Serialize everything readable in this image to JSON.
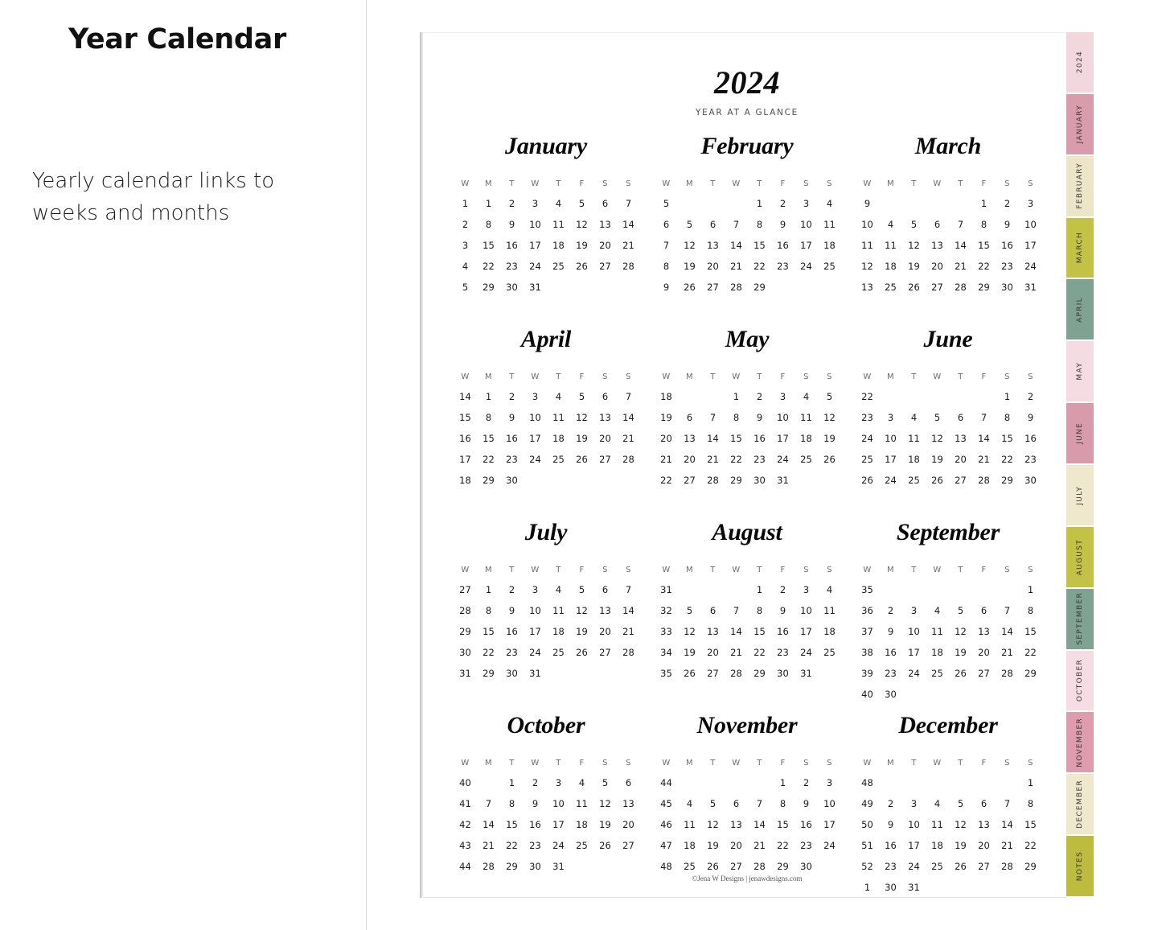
{
  "left_panel": {
    "title": "Year Calendar",
    "description": "Yearly calendar links to weeks and months"
  },
  "calendar": {
    "year": "2024",
    "subtitle": "YEAR AT A GLANCE",
    "footer": "©Jena W Designs | jenawdesigns.com",
    "day_headers": [
      "W",
      "M",
      "T",
      "W",
      "T",
      "F",
      "S",
      "S"
    ],
    "months": [
      {
        "name": "January",
        "rows": [
          [
            "1",
            "1",
            "2",
            "3",
            "4",
            "5",
            "6",
            "7"
          ],
          [
            "2",
            "8",
            "9",
            "10",
            "11",
            "12",
            "13",
            "14"
          ],
          [
            "3",
            "15",
            "16",
            "17",
            "18",
            "19",
            "20",
            "21"
          ],
          [
            "4",
            "22",
            "23",
            "24",
            "25",
            "26",
            "27",
            "28"
          ],
          [
            "5",
            "29",
            "30",
            "31",
            "",
            "",
            "",
            ""
          ]
        ]
      },
      {
        "name": "February",
        "rows": [
          [
            "5",
            "",
            "",
            "",
            "1",
            "2",
            "3",
            "4"
          ],
          [
            "6",
            "5",
            "6",
            "7",
            "8",
            "9",
            "10",
            "11"
          ],
          [
            "7",
            "12",
            "13",
            "14",
            "15",
            "16",
            "17",
            "18"
          ],
          [
            "8",
            "19",
            "20",
            "21",
            "22",
            "23",
            "24",
            "25"
          ],
          [
            "9",
            "26",
            "27",
            "28",
            "29",
            "",
            "",
            ""
          ]
        ]
      },
      {
        "name": "March",
        "rows": [
          [
            "9",
            "",
            "",
            "",
            "",
            "1",
            "2",
            "3"
          ],
          [
            "10",
            "4",
            "5",
            "6",
            "7",
            "8",
            "9",
            "10"
          ],
          [
            "11",
            "11",
            "12",
            "13",
            "14",
            "15",
            "16",
            "17"
          ],
          [
            "12",
            "18",
            "19",
            "20",
            "21",
            "22",
            "23",
            "24"
          ],
          [
            "13",
            "25",
            "26",
            "27",
            "28",
            "29",
            "30",
            "31"
          ]
        ]
      },
      {
        "name": "April",
        "rows": [
          [
            "14",
            "1",
            "2",
            "3",
            "4",
            "5",
            "6",
            "7"
          ],
          [
            "15",
            "8",
            "9",
            "10",
            "11",
            "12",
            "13",
            "14"
          ],
          [
            "16",
            "15",
            "16",
            "17",
            "18",
            "19",
            "20",
            "21"
          ],
          [
            "17",
            "22",
            "23",
            "24",
            "25",
            "26",
            "27",
            "28"
          ],
          [
            "18",
            "29",
            "30",
            "",
            "",
            "",
            "",
            ""
          ]
        ]
      },
      {
        "name": "May",
        "rows": [
          [
            "18",
            "",
            "",
            "1",
            "2",
            "3",
            "4",
            "5"
          ],
          [
            "19",
            "6",
            "7",
            "8",
            "9",
            "10",
            "11",
            "12"
          ],
          [
            "20",
            "13",
            "14",
            "15",
            "16",
            "17",
            "18",
            "19"
          ],
          [
            "21",
            "20",
            "21",
            "22",
            "23",
            "24",
            "25",
            "26"
          ],
          [
            "22",
            "27",
            "28",
            "29",
            "30",
            "31",
            "",
            ""
          ]
        ]
      },
      {
        "name": "June",
        "rows": [
          [
            "22",
            "",
            "",
            "",
            "",
            "",
            "1",
            "2"
          ],
          [
            "23",
            "3",
            "4",
            "5",
            "6",
            "7",
            "8",
            "9"
          ],
          [
            "24",
            "10",
            "11",
            "12",
            "13",
            "14",
            "15",
            "16"
          ],
          [
            "25",
            "17",
            "18",
            "19",
            "20",
            "21",
            "22",
            "23"
          ],
          [
            "26",
            "24",
            "25",
            "26",
            "27",
            "28",
            "29",
            "30"
          ]
        ]
      },
      {
        "name": "July",
        "rows": [
          [
            "27",
            "1",
            "2",
            "3",
            "4",
            "5",
            "6",
            "7"
          ],
          [
            "28",
            "8",
            "9",
            "10",
            "11",
            "12",
            "13",
            "14"
          ],
          [
            "29",
            "15",
            "16",
            "17",
            "18",
            "19",
            "20",
            "21"
          ],
          [
            "30",
            "22",
            "23",
            "24",
            "25",
            "26",
            "27",
            "28"
          ],
          [
            "31",
            "29",
            "30",
            "31",
            "",
            "",
            "",
            ""
          ]
        ]
      },
      {
        "name": "August",
        "rows": [
          [
            "31",
            "",
            "",
            "",
            "1",
            "2",
            "3",
            "4"
          ],
          [
            "32",
            "5",
            "6",
            "7",
            "8",
            "9",
            "10",
            "11"
          ],
          [
            "33",
            "12",
            "13",
            "14",
            "15",
            "16",
            "17",
            "18"
          ],
          [
            "34",
            "19",
            "20",
            "21",
            "22",
            "23",
            "24",
            "25"
          ],
          [
            "35",
            "26",
            "27",
            "28",
            "29",
            "30",
            "31",
            ""
          ]
        ]
      },
      {
        "name": "September",
        "rows": [
          [
            "35",
            "",
            "",
            "",
            "",
            "",
            "",
            "1"
          ],
          [
            "36",
            "2",
            "3",
            "4",
            "5",
            "6",
            "7",
            "8"
          ],
          [
            "37",
            "9",
            "10",
            "11",
            "12",
            "13",
            "14",
            "15"
          ],
          [
            "38",
            "16",
            "17",
            "18",
            "19",
            "20",
            "21",
            "22"
          ],
          [
            "39",
            "23",
            "24",
            "25",
            "26",
            "27",
            "28",
            "29"
          ],
          [
            "40",
            "30",
            "",
            "",
            "",
            "",
            "",
            ""
          ]
        ]
      },
      {
        "name": "October",
        "rows": [
          [
            "40",
            "",
            "1",
            "2",
            "3",
            "4",
            "5",
            "6"
          ],
          [
            "41",
            "7",
            "8",
            "9",
            "10",
            "11",
            "12",
            "13"
          ],
          [
            "42",
            "14",
            "15",
            "16",
            "17",
            "18",
            "19",
            "20"
          ],
          [
            "43",
            "21",
            "22",
            "23",
            "24",
            "25",
            "26",
            "27"
          ],
          [
            "44",
            "28",
            "29",
            "30",
            "31",
            "",
            "",
            ""
          ]
        ]
      },
      {
        "name": "November",
        "rows": [
          [
            "44",
            "",
            "",
            "",
            "",
            "1",
            "2",
            "3"
          ],
          [
            "45",
            "4",
            "5",
            "6",
            "7",
            "8",
            "9",
            "10"
          ],
          [
            "46",
            "11",
            "12",
            "13",
            "14",
            "15",
            "16",
            "17"
          ],
          [
            "47",
            "18",
            "19",
            "20",
            "21",
            "22",
            "23",
            "24"
          ],
          [
            "48",
            "25",
            "26",
            "27",
            "28",
            "29",
            "30",
            ""
          ]
        ]
      },
      {
        "name": "December",
        "rows": [
          [
            "48",
            "",
            "",
            "",
            "",
            "",
            "",
            "1"
          ],
          [
            "49",
            "2",
            "3",
            "4",
            "5",
            "6",
            "7",
            "8"
          ],
          [
            "50",
            "9",
            "10",
            "11",
            "12",
            "13",
            "14",
            "15"
          ],
          [
            "51",
            "16",
            "17",
            "18",
            "19",
            "20",
            "21",
            "22"
          ],
          [
            "52",
            "23",
            "24",
            "25",
            "26",
            "27",
            "28",
            "29"
          ],
          [
            "1",
            "30",
            "31",
            "",
            "",
            "",
            "",
            ""
          ]
        ]
      }
    ]
  },
  "tab_strip": {
    "tabs": [
      {
        "label": "2024",
        "color": "#F3D7DE"
      },
      {
        "label": "JANUARY",
        "color": "#D99CAC"
      },
      {
        "label": "FEBRUARY",
        "color": "#EDE5C8"
      },
      {
        "label": "MARCH",
        "color": "#C2C246"
      },
      {
        "label": "APRIL",
        "color": "#7FA292"
      },
      {
        "label": "MAY",
        "color": "#F5DCE3"
      },
      {
        "label": "JUNE",
        "color": "#D89BAB"
      },
      {
        "label": "JULY",
        "color": "#EFE8CD"
      },
      {
        "label": "AUGUST",
        "color": "#C2C246"
      },
      {
        "label": "SEPTEMBER",
        "color": "#7FA292"
      },
      {
        "label": "OCTOBER",
        "color": "#F6DDE4"
      },
      {
        "label": "NOVEMBER",
        "color": "#DE9CAE"
      },
      {
        "label": "DECEMBER",
        "color": "#EFE8CD"
      },
      {
        "label": "NOTES",
        "color": "#BDBC3F"
      }
    ]
  }
}
